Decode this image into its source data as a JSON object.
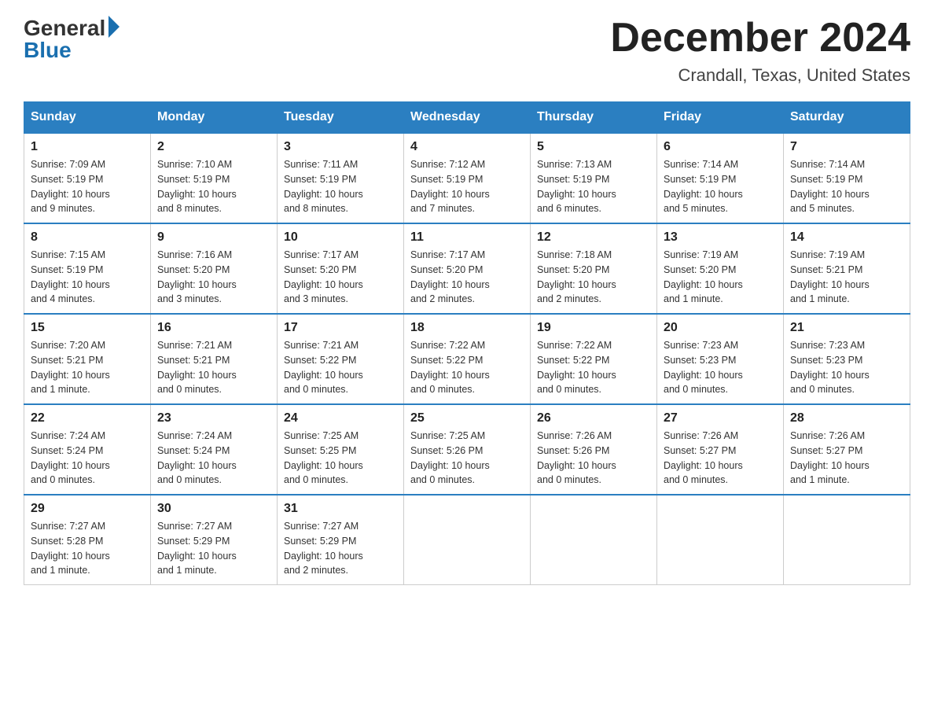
{
  "logo": {
    "general": "General",
    "blue": "Blue"
  },
  "title": {
    "month": "December 2024",
    "location": "Crandall, Texas, United States"
  },
  "days_of_week": [
    "Sunday",
    "Monday",
    "Tuesday",
    "Wednesday",
    "Thursday",
    "Friday",
    "Saturday"
  ],
  "weeks": [
    [
      {
        "num": "1",
        "sunrise": "7:09 AM",
        "sunset": "5:19 PM",
        "daylight": "10 hours and 9 minutes."
      },
      {
        "num": "2",
        "sunrise": "7:10 AM",
        "sunset": "5:19 PM",
        "daylight": "10 hours and 8 minutes."
      },
      {
        "num": "3",
        "sunrise": "7:11 AM",
        "sunset": "5:19 PM",
        "daylight": "10 hours and 8 minutes."
      },
      {
        "num": "4",
        "sunrise": "7:12 AM",
        "sunset": "5:19 PM",
        "daylight": "10 hours and 7 minutes."
      },
      {
        "num": "5",
        "sunrise": "7:13 AM",
        "sunset": "5:19 PM",
        "daylight": "10 hours and 6 minutes."
      },
      {
        "num": "6",
        "sunrise": "7:14 AM",
        "sunset": "5:19 PM",
        "daylight": "10 hours and 5 minutes."
      },
      {
        "num": "7",
        "sunrise": "7:14 AM",
        "sunset": "5:19 PM",
        "daylight": "10 hours and 5 minutes."
      }
    ],
    [
      {
        "num": "8",
        "sunrise": "7:15 AM",
        "sunset": "5:19 PM",
        "daylight": "10 hours and 4 minutes."
      },
      {
        "num": "9",
        "sunrise": "7:16 AM",
        "sunset": "5:20 PM",
        "daylight": "10 hours and 3 minutes."
      },
      {
        "num": "10",
        "sunrise": "7:17 AM",
        "sunset": "5:20 PM",
        "daylight": "10 hours and 3 minutes."
      },
      {
        "num": "11",
        "sunrise": "7:17 AM",
        "sunset": "5:20 PM",
        "daylight": "10 hours and 2 minutes."
      },
      {
        "num": "12",
        "sunrise": "7:18 AM",
        "sunset": "5:20 PM",
        "daylight": "10 hours and 2 minutes."
      },
      {
        "num": "13",
        "sunrise": "7:19 AM",
        "sunset": "5:20 PM",
        "daylight": "10 hours and 1 minute."
      },
      {
        "num": "14",
        "sunrise": "7:19 AM",
        "sunset": "5:21 PM",
        "daylight": "10 hours and 1 minute."
      }
    ],
    [
      {
        "num": "15",
        "sunrise": "7:20 AM",
        "sunset": "5:21 PM",
        "daylight": "10 hours and 1 minute."
      },
      {
        "num": "16",
        "sunrise": "7:21 AM",
        "sunset": "5:21 PM",
        "daylight": "10 hours and 0 minutes."
      },
      {
        "num": "17",
        "sunrise": "7:21 AM",
        "sunset": "5:22 PM",
        "daylight": "10 hours and 0 minutes."
      },
      {
        "num": "18",
        "sunrise": "7:22 AM",
        "sunset": "5:22 PM",
        "daylight": "10 hours and 0 minutes."
      },
      {
        "num": "19",
        "sunrise": "7:22 AM",
        "sunset": "5:22 PM",
        "daylight": "10 hours and 0 minutes."
      },
      {
        "num": "20",
        "sunrise": "7:23 AM",
        "sunset": "5:23 PM",
        "daylight": "10 hours and 0 minutes."
      },
      {
        "num": "21",
        "sunrise": "7:23 AM",
        "sunset": "5:23 PM",
        "daylight": "10 hours and 0 minutes."
      }
    ],
    [
      {
        "num": "22",
        "sunrise": "7:24 AM",
        "sunset": "5:24 PM",
        "daylight": "10 hours and 0 minutes."
      },
      {
        "num": "23",
        "sunrise": "7:24 AM",
        "sunset": "5:24 PM",
        "daylight": "10 hours and 0 minutes."
      },
      {
        "num": "24",
        "sunrise": "7:25 AM",
        "sunset": "5:25 PM",
        "daylight": "10 hours and 0 minutes."
      },
      {
        "num": "25",
        "sunrise": "7:25 AM",
        "sunset": "5:26 PM",
        "daylight": "10 hours and 0 minutes."
      },
      {
        "num": "26",
        "sunrise": "7:26 AM",
        "sunset": "5:26 PM",
        "daylight": "10 hours and 0 minutes."
      },
      {
        "num": "27",
        "sunrise": "7:26 AM",
        "sunset": "5:27 PM",
        "daylight": "10 hours and 0 minutes."
      },
      {
        "num": "28",
        "sunrise": "7:26 AM",
        "sunset": "5:27 PM",
        "daylight": "10 hours and 1 minute."
      }
    ],
    [
      {
        "num": "29",
        "sunrise": "7:27 AM",
        "sunset": "5:28 PM",
        "daylight": "10 hours and 1 minute."
      },
      {
        "num": "30",
        "sunrise": "7:27 AM",
        "sunset": "5:29 PM",
        "daylight": "10 hours and 1 minute."
      },
      {
        "num": "31",
        "sunrise": "7:27 AM",
        "sunset": "5:29 PM",
        "daylight": "10 hours and 2 minutes."
      },
      null,
      null,
      null,
      null
    ]
  ]
}
